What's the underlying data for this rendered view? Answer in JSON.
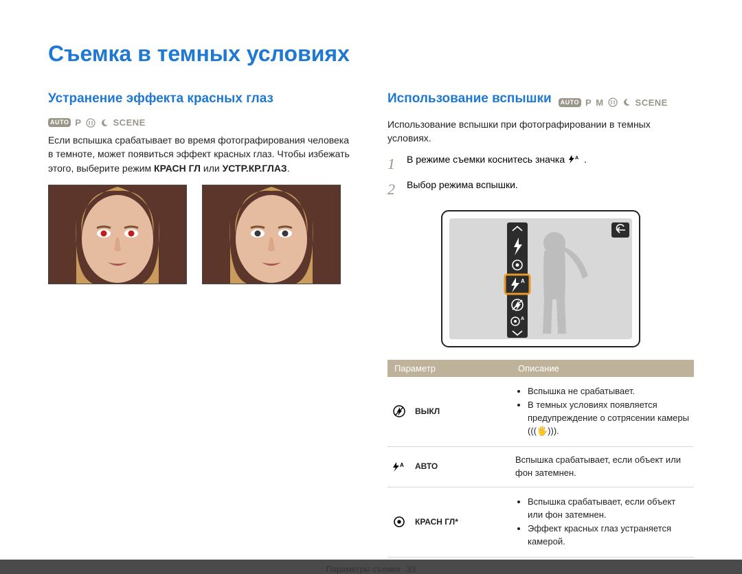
{
  "page": {
    "title": "Съемка в темных условиях",
    "footer_section": "Параметры съемки",
    "page_number": "33"
  },
  "left": {
    "heading": "Устранение эффекта красных глаз",
    "mode_icons": {
      "auto": "AUTO",
      "p": "P",
      "scene": "SCENE"
    },
    "body_text": "Если вспышка срабатывает во время фотографирования человека в темноте, может появиться эффект красных глаз. Чтобы избежать этого, выберите режим ",
    "mode1": "КРАСН ГЛ",
    "or": " или ",
    "mode2": "УСТР.КР.ГЛАЗ",
    "body_end": "."
  },
  "right": {
    "heading": "Использование вспышки",
    "mode_icons": {
      "auto": "AUTO",
      "p": "P",
      "m": "M",
      "scene": "SCENE"
    },
    "intro": "Использование вспышки при фотографировании в темных условиях.",
    "steps": [
      "В режиме съемки коснитесь значка ",
      "Выбор режима вспышки."
    ],
    "step1_end": ".",
    "table": {
      "header_param": "Параметр",
      "header_desc": "Описание",
      "rows": [
        {
          "id": "off",
          "label": "ВЫКЛ",
          "desc": [
            "Вспышка не срабатывает.",
            "В темных условиях появляется предупреждение о сотрясении камеры (((🖐)))."
          ]
        },
        {
          "id": "auto",
          "label": "АВТО",
          "desc_text": "Вспышка срабатывает, если объект или фон затемнен."
        },
        {
          "id": "redeye",
          "label": "КРАСН ГЛ*",
          "desc": [
            "Вспышка срабатывает, если объект или фон затемнен.",
            "Эффект красных глаз устраняется камерой."
          ]
        }
      ]
    }
  }
}
